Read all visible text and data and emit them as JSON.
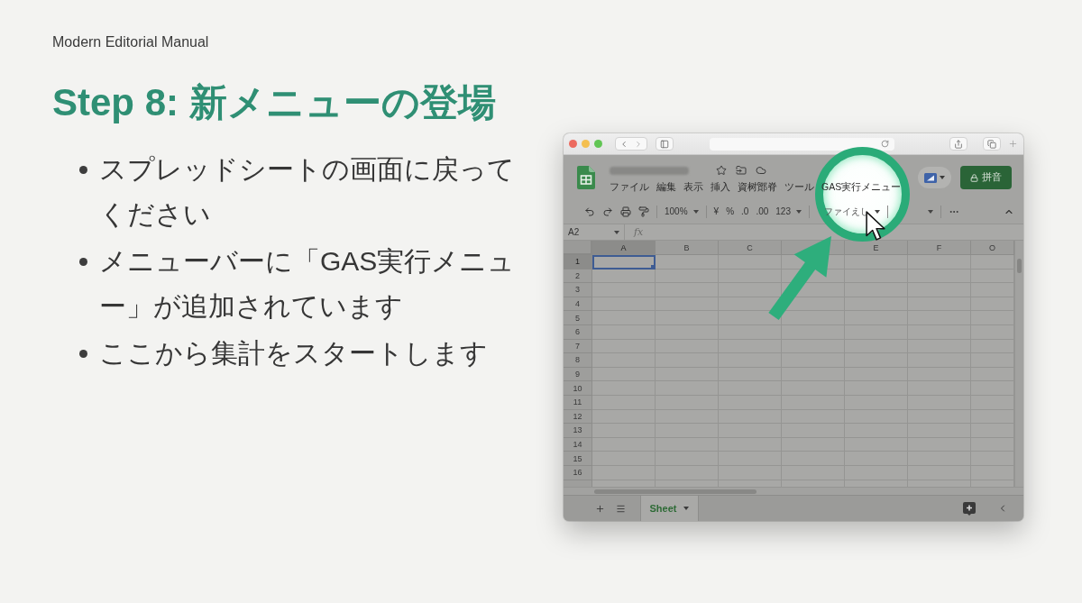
{
  "header": {
    "brand": "Modern Editorial Manual"
  },
  "title": "Step 8: 新メニューの登場",
  "bullets": [
    "スプレッドシートの画面に戻ってください",
    "メニューバーに「GAS実行メニュー」が追加されています",
    "ここから集計をスタートします"
  ],
  "browser": {
    "sheet": {
      "menu": [
        "ファイル",
        "編集",
        "表示",
        "挿入",
        "資树鄮脊",
        "ツール",
        "GAS実行メニュー"
      ],
      "share_button": "拼音",
      "toolbar": {
        "zoom": "100%",
        "format_buttons": [
          "¥",
          "%",
          ".0",
          ".00"
        ],
        "number_format": "123",
        "font": "ファイえし"
      },
      "name_box": "A2",
      "formula_label": "fx",
      "grid": {
        "columns": [
          {
            "label": "A",
            "selected": true
          },
          {
            "label": "B",
            "selected": false
          },
          {
            "label": "C",
            "selected": false
          },
          {
            "selected": false
          },
          {
            "label": "E",
            "selected": false
          },
          {
            "label": "F",
            "selected": false
          },
          {
            "label": "O",
            "selected": false
          }
        ],
        "rows": [
          {
            "label": "1",
            "selected": true
          },
          {
            "label": "2",
            "selected": false
          },
          {
            "label": "3",
            "selected": false
          },
          {
            "label": "4",
            "selected": false
          },
          {
            "label": "5",
            "selected": false
          },
          {
            "label": "6",
            "selected": false
          },
          {
            "label": "7",
            "selected": false
          },
          {
            "label": "8",
            "selected": false
          },
          {
            "label": "9",
            "selected": false
          },
          {
            "label": "10",
            "selected": false
          },
          {
            "label": "11",
            "selected": false
          },
          {
            "label": "12",
            "selected": false
          },
          {
            "label": "13",
            "selected": false
          },
          {
            "label": "14",
            "selected": false
          },
          {
            "label": "15",
            "selected": false
          },
          {
            "label": "16",
            "selected": false
          }
        ]
      },
      "tabs": [
        {
          "label": "Sheet",
          "selected": true
        }
      ]
    }
  }
}
